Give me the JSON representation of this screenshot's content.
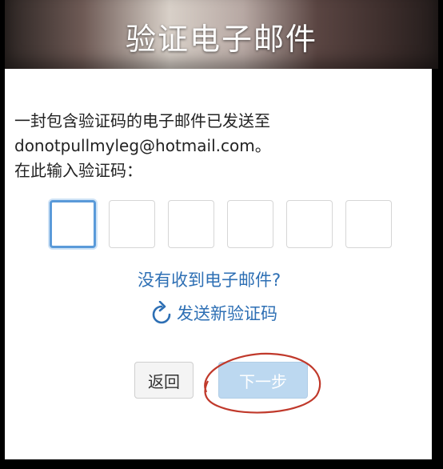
{
  "window": {
    "title": "验证电子邮件"
  },
  "message": {
    "line1": "一封包含验证码的电子邮件已发送至",
    "line2": "donotpullmyleg@hotmail.com。",
    "line3": "在此输入验证码："
  },
  "code_inputs": {
    "count": 6,
    "values": [
      "",
      "",
      "",
      "",
      "",
      ""
    ]
  },
  "links": {
    "no_email": "没有收到电子邮件?",
    "resend": "发送新验证码"
  },
  "buttons": {
    "back": "返回",
    "next": "下一步"
  },
  "colors": {
    "link": "#2d6fb4",
    "next_disabled_bg": "#bcd8f0",
    "focus_border": "#5a9ad9",
    "annotation_red": "#c0392b"
  },
  "icons": {
    "resend": "refresh-icon"
  }
}
